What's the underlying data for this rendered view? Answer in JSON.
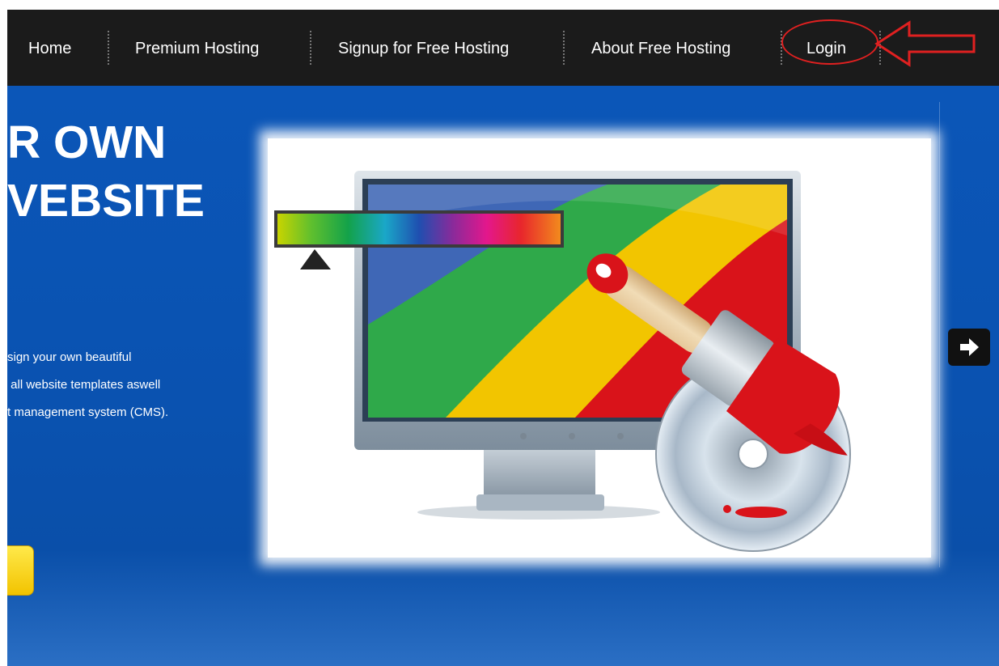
{
  "nav": {
    "items": [
      {
        "label": "Home"
      },
      {
        "label": "Premium Hosting"
      },
      {
        "label": "Signup for Free Hosting"
      },
      {
        "label": "About Free Hosting"
      },
      {
        "label": "Login"
      }
    ]
  },
  "hero": {
    "headline_line1": "R OWN",
    "headline_line2": "VEBSITE",
    "text_line1": "sign your own beautiful",
    "text_line2": " all website templates aswell",
    "text_line3": "t management system (CMS)."
  },
  "colors": {
    "navbar_bg": "#1b1b1b",
    "hero_bg": "#0b56b8",
    "annotation_red": "#e02020",
    "button_yellow": "#ffd600"
  },
  "icons": {
    "next_slide": "arrow-right-icon",
    "annotation": "left-arrow-outline"
  }
}
